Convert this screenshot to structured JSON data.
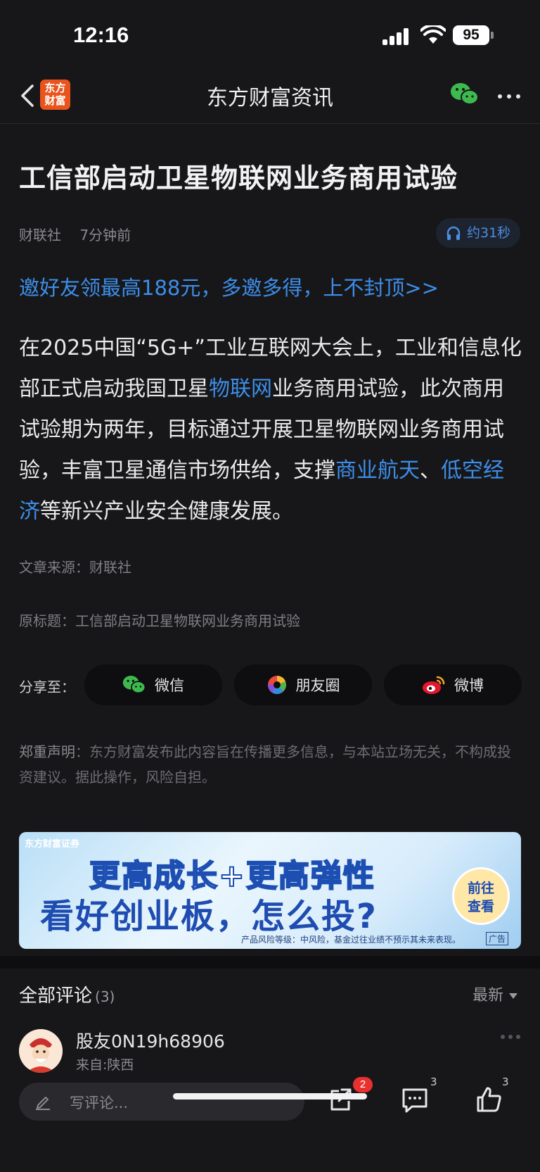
{
  "status_bar": {
    "time": "12:16",
    "battery": "95"
  },
  "nav": {
    "logo_text_line1": "东方",
    "logo_text_line2": "财富",
    "title": "东方财富资讯"
  },
  "article": {
    "headline": "工信部启动卫星物联网业务商用试验",
    "source_name": "财联社",
    "time_ago": "7分钟前",
    "listen_label": "约31秒",
    "promo": "邀好友领最高188元，多邀多得，上不封顶>>",
    "body_parts": [
      "在2025中国“5G+”工业互联网大会上，工业和信息化部正式启动我国卫星",
      "物联网",
      "业务商用试验，此次商用试验期为两年，目标通过开展卫星物联网业务商用试验，丰富卫星通信市场供给，支撑",
      "商业航天",
      "、",
      "低空经济",
      "等新兴产业安全健康发展。"
    ],
    "source_line": "文章来源：财联社",
    "original_title": "原标题：工信部启动卫星物联网业务商用试验"
  },
  "share": {
    "label": "分享至：",
    "buttons": [
      "微信",
      "朋友圈",
      "微博"
    ]
  },
  "disclaimer": {
    "title": "郑重声明",
    "text": "：东方财富发布此内容旨在传播更多信息，与本站立场无关，不构成投资建议。据此操作，风险自担。"
  },
  "ad": {
    "brand": "东方财富证券",
    "line1": "更高成长+更高弹性",
    "line2": "看好创业板，怎么投?",
    "cta_line1": "前往",
    "cta_line2": "查看",
    "note": "产品风险等级：中风险，基金过往业绩不预示其未来表现。",
    "tag": "广告"
  },
  "comments": {
    "title": "全部评论",
    "count": "(3)",
    "sort": "最新",
    "first": {
      "user": "股友0N19h68906",
      "location": "来自:陕西"
    }
  },
  "toolbar": {
    "placeholder": "写评论...",
    "share_badge": "2",
    "comment_count": "3",
    "like_count": "3"
  },
  "colors": {
    "background": "#17171a",
    "link": "#3d8ee8",
    "badge": "#e8312f",
    "logo": "#e8541c"
  }
}
